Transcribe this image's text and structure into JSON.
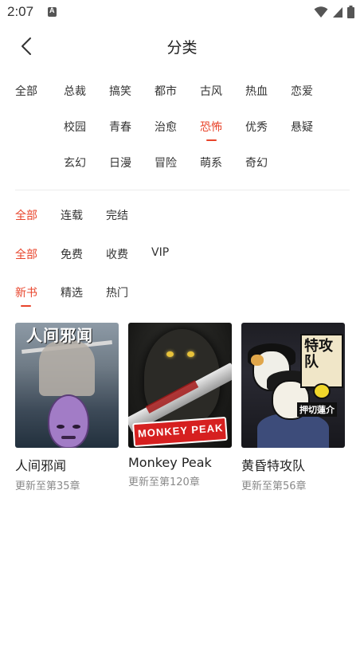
{
  "status_bar": {
    "time": "2:07",
    "icons": [
      "notification-a-icon",
      "wifi-icon",
      "signal-icon",
      "battery-icon"
    ]
  },
  "header": {
    "title": "分类",
    "back_icon": "chevron-left-icon"
  },
  "genres": {
    "all_label": "全部",
    "items": [
      {
        "label": "总裁",
        "active": false
      },
      {
        "label": "搞笑",
        "active": false
      },
      {
        "label": "都市",
        "active": false
      },
      {
        "label": "古风",
        "active": false
      },
      {
        "label": "热血",
        "active": false
      },
      {
        "label": "恋爱",
        "active": false
      },
      {
        "label": "校园",
        "active": false
      },
      {
        "label": "青春",
        "active": false
      },
      {
        "label": "治愈",
        "active": false
      },
      {
        "label": "恐怖",
        "active": true
      },
      {
        "label": "优秀",
        "active": false
      },
      {
        "label": "悬疑",
        "active": false
      },
      {
        "label": "玄幻",
        "active": false
      },
      {
        "label": "日漫",
        "active": false
      },
      {
        "label": "冒险",
        "active": false
      },
      {
        "label": "萌系",
        "active": false
      },
      {
        "label": "奇幻",
        "active": false
      }
    ]
  },
  "filters": {
    "status": {
      "options": [
        "全部",
        "连载",
        "完结"
      ],
      "selected": 0
    },
    "price": {
      "options": [
        "全部",
        "免费",
        "收费",
        "VIP"
      ],
      "selected": 0
    },
    "sort": {
      "options": [
        "新书",
        "精选",
        "热门"
      ],
      "selected": 0
    }
  },
  "comics": [
    {
      "title": "人间邪闻",
      "subtitle": "更新至第35章",
      "cover_text": "人间邪闻"
    },
    {
      "title": "Monkey Peak",
      "subtitle": "更新至第120章",
      "cover_text": "MONKEY PEAK"
    },
    {
      "title": "黄昏特攻队",
      "subtitle": "更新至第56章",
      "cover_text": "特攻队",
      "cover_sub": "押切蓮介"
    }
  ],
  "colors": {
    "accent": "#e8442b",
    "text": "#222222",
    "muted": "#8a8a8a",
    "divider": "#ececec"
  }
}
